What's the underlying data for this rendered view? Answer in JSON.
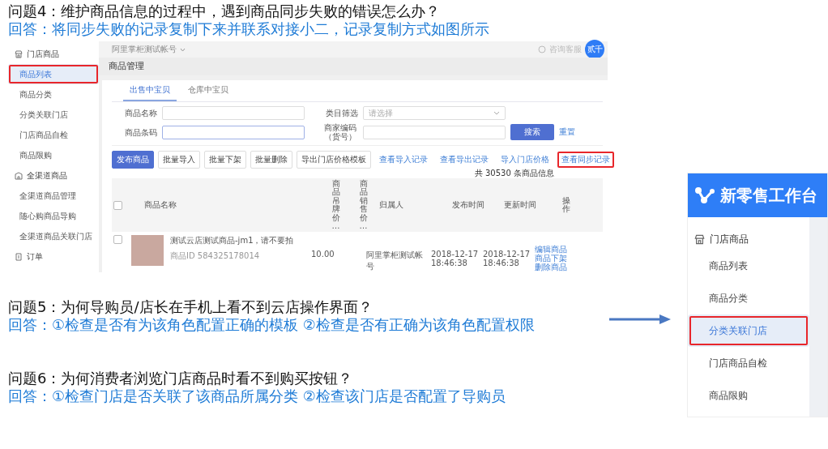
{
  "faq_4": {
    "question": "问题4：维护商品信息的过程中，遇到商品同步失败的错误怎么办？",
    "answer": "回答：将同步失败的记录复制下来并联系对接小二，记录复制方式如图所示"
  },
  "product_screenshot": {
    "account": "阿里掌柜测试帐号",
    "help": "咨询客服",
    "avatar": "贰千",
    "sidebar": [
      {
        "label": "门店商品",
        "items": [
          {
            "label": "商品列表",
            "selected": true,
            "highlighted": true
          },
          {
            "label": "商品分类",
            "selected": false,
            "highlighted": false
          },
          {
            "label": "分类关联门店",
            "selected": false,
            "highlighted": false
          },
          {
            "label": "门店商品自检",
            "selected": false,
            "highlighted": false
          },
          {
            "label": "商品限购",
            "selected": false,
            "highlighted": false
          }
        ]
      },
      {
        "label": "全渠道商品",
        "items": [
          {
            "label": "全渠道商品管理",
            "selected": false,
            "highlighted": false
          },
          {
            "label": "随心购商品导购",
            "selected": false,
            "highlighted": false
          },
          {
            "label": "全渠道商品关联门店",
            "selected": false,
            "highlighted": false
          }
        ]
      },
      {
        "label": "订单"
      }
    ],
    "page_title": "商品管理",
    "tabs": [
      {
        "label": "出售中宝贝",
        "selected": true
      },
      {
        "label": "仓库中宝贝",
        "selected": false
      }
    ],
    "form": [
      {
        "label": "商品名称",
        "kind": "input",
        "focused": false
      },
      {
        "label": "类目筛选",
        "kind": "select",
        "placeholder": "请选择",
        "focused": false
      },
      {
        "label": "商品条码",
        "kind": "input",
        "focused": true
      },
      {
        "label": "商家编码（货号）",
        "kind": "input",
        "focused": false
      }
    ],
    "search_button": "搜索",
    "reset_link": "重置",
    "buttons": [
      {
        "label": "发布商品",
        "primary": true
      },
      {
        "label": "批量导入",
        "primary": false
      },
      {
        "label": "批量下架",
        "primary": false
      },
      {
        "label": "批量删除",
        "primary": false
      },
      {
        "label": "导出门店价格模板",
        "primary": false
      }
    ],
    "links": [
      {
        "label": "查看导入记录",
        "highlighted": false
      },
      {
        "label": "查看导出记录",
        "highlighted": false
      },
      {
        "label": "导入门店价格",
        "highlighted": false
      },
      {
        "label": "查看同步记录",
        "highlighted": true
      }
    ],
    "count": "共 30530 条商品信息",
    "columns": [
      {
        "kind": "checkbox",
        "checked": false
      },
      {
        "kind": "text",
        "label": "商品名称"
      },
      {
        "kind": "vertical",
        "label": "商品吊牌价…"
      },
      {
        "kind": "vertical",
        "label": "商品销售价…"
      },
      {
        "kind": "text",
        "label": "归属人"
      },
      {
        "kind": "text",
        "label": "发布时间"
      },
      {
        "kind": "text",
        "label": "更新时间"
      },
      {
        "kind": "vertical",
        "label": "操作"
      }
    ],
    "rows": [
      {
        "checked": false,
        "name": "测试云店测试商品-jm1，请不要拍",
        "id": "商品ID 584325178014",
        "tag_price": "10.00",
        "owner": "阿里掌柜测试帐号",
        "published": "2018-12-17 18:46:38",
        "updated": "2018-12-17 18:46:38",
        "actions": [
          "编辑商品",
          "商品下架",
          "删除商品"
        ]
      }
    ]
  },
  "faq_5": {
    "question": "问题5：为何导购员/店长在手机上看不到云店操作界面？",
    "answer": "回答：①检查是否有为该角色配置正确的模板 ②检查是否有正确为该角色配置权限"
  },
  "faq_6": {
    "question": "问题6：为何消费者浏览门店商品时看不到购买按钮？",
    "answer": "回答：①检查门店是否关联了该商品所属分类 ②检查该门店是否配置了导购员"
  },
  "category_screenshot": {
    "title": "新零售工作台",
    "group": "门店商品",
    "items": [
      {
        "label": "商品列表",
        "selected": false,
        "highlighted": false
      },
      {
        "label": "商品分类",
        "selected": false,
        "highlighted": false
      },
      {
        "label": "分类关联门店",
        "selected": true,
        "highlighted": true
      },
      {
        "label": "门店商品自检",
        "selected": false,
        "highlighted": false
      },
      {
        "label": "商品限购",
        "selected": false,
        "highlighted": false
      }
    ]
  }
}
